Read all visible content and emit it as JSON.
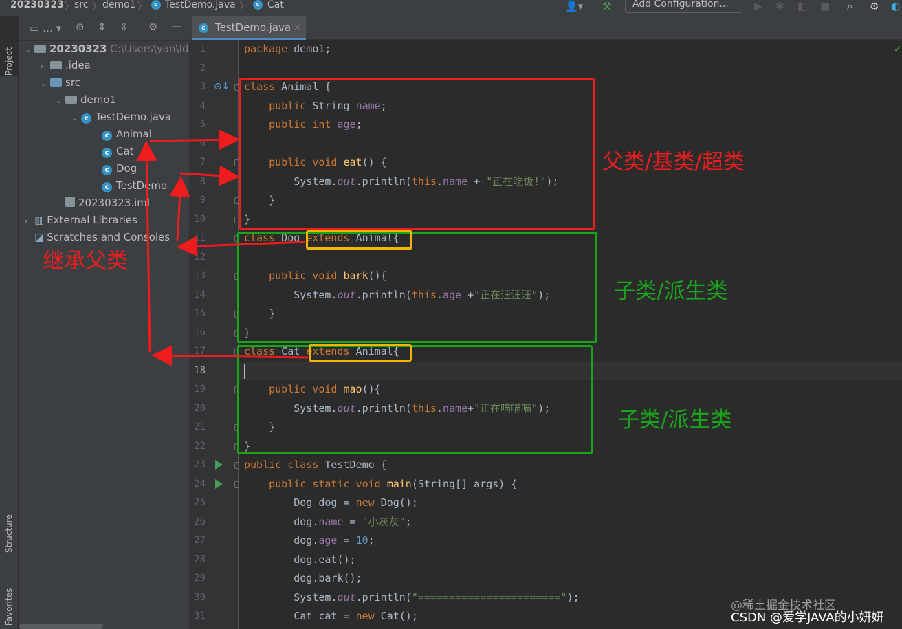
{
  "breadcrumb": {
    "project": "20230323",
    "folder1": "src",
    "folder2": "demo1",
    "file": "TestDemo.java",
    "symbol": "Cat"
  },
  "toolbar": {
    "run_config_label": "Add Configuration..."
  },
  "stripe": {
    "project_tab": "Project",
    "structure_tab": "Structure",
    "favorites_tab": "Favorites"
  },
  "project_tree": {
    "root": "20230323",
    "root_path": "C:\\Users\\yan\\Ide",
    "items": [
      {
        "label": ".idea"
      },
      {
        "label": "src"
      },
      {
        "label": "demo1"
      },
      {
        "label": "TestDemo.java"
      },
      {
        "label": "Animal"
      },
      {
        "label": "Cat"
      },
      {
        "label": "Dog"
      },
      {
        "label": "TestDemo"
      },
      {
        "label": "20230323.iml"
      },
      {
        "label": "External Libraries"
      },
      {
        "label": "Scratches and Consoles"
      }
    ]
  },
  "editor": {
    "tab_label": "TestDemo.java",
    "current_line": 18,
    "line_numbers": [
      "1",
      "2",
      "3",
      "4",
      "5",
      "6",
      "7",
      "8",
      "9",
      "10",
      "11",
      "12",
      "13",
      "14",
      "15",
      "16",
      "17",
      "18",
      "19",
      "20",
      "21",
      "22",
      "23",
      "24",
      "25",
      "26",
      "27",
      "28",
      "29",
      "30",
      "31"
    ],
    "strings": {
      "eat_msg": "\"正在吃饭!\"",
      "bark_msg": "\"正在汪汪汪\"",
      "mao_msg": "\"正在喵喵喵\"",
      "dog_name": "\"小灰灰\"",
      "separator": "\"=======================\"",
      "age_value": "10"
    }
  },
  "annotations": {
    "parent_class": "父类/基类/超类",
    "child_class_1": "子类/派生类",
    "child_class_2": "子类/派生类",
    "inherit": "继承父类"
  },
  "watermark": {
    "line1": "@稀土掘金技术社区",
    "line2": "CSDN @爱学JAVA的小妍妍"
  },
  "colors": {
    "red": "#ee1c1c",
    "green": "#19a51a",
    "yellow": "#f4b400"
  }
}
